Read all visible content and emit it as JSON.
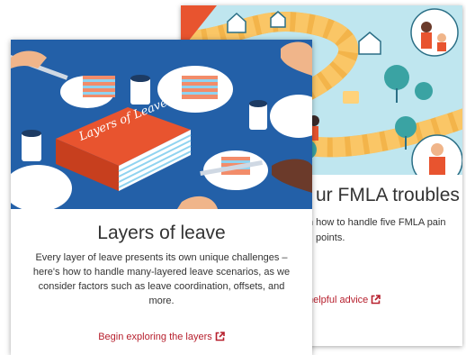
{
  "back_card": {
    "title": "ur FMLA troubles",
    "description_line1": "n how to handle five FMLA pain",
    "description_line2": "points.",
    "link_label": "helpful advice",
    "link_icon": "external-link-icon",
    "accent_color": "#b7202e"
  },
  "front_card": {
    "illustration_text": "Layers of Leave",
    "title": "Layers of leave",
    "description": "Every layer of leave presents its own unique challenges – here's how to handle many-layered leave scenarios, as we consider factors such as leave coordination, offsets, and more.",
    "link_label": "Begin exploring the layers",
    "link_icon": "external-link-icon",
    "accent_color": "#b7202e"
  }
}
